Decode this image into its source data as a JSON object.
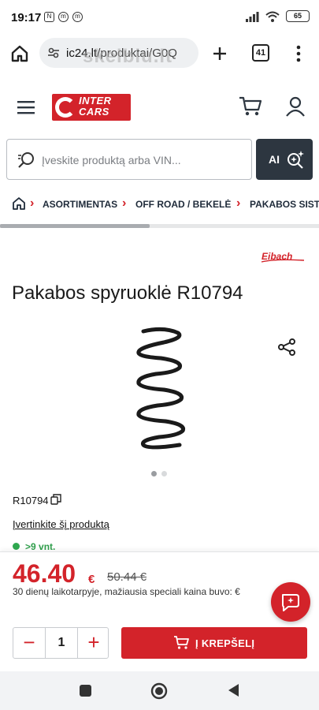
{
  "status_bar": {
    "time": "19:17",
    "battery": "65"
  },
  "browser": {
    "url_domain": "ic24.lt",
    "url_path": "/produktai/G0Q",
    "watermark": "skelbiu.lt",
    "tab_count": "41"
  },
  "header": {
    "logo_text_line1": "INTER",
    "logo_text_line2": "CARS"
  },
  "search": {
    "placeholder": "Įveskite produktą arba VIN...",
    "ai_label": "AI"
  },
  "breadcrumb": {
    "items": [
      "ASORTIMENTAS",
      "OFF ROAD / BEKELĖ",
      "PAKABOS SIST"
    ]
  },
  "product": {
    "brand": "Eibach",
    "title": "Pakabos spyruoklė R10794",
    "sku": "R10794",
    "rate_link": "Įvertinkite šį produktą",
    "stock": ">9 vnt.",
    "image_dots_active": 0
  },
  "purchase": {
    "price": "46.40",
    "currency": "€",
    "old_price": "50.44 €",
    "note": "30 dienų laikotarpyje, mažiausia speciali kaina buvo: €",
    "quantity": "1",
    "cart_label": "Į KREPŠELĮ"
  },
  "colors": {
    "accent": "#d3232a",
    "dark_button": "#2d3640",
    "stock_green": "#2fa84f"
  }
}
